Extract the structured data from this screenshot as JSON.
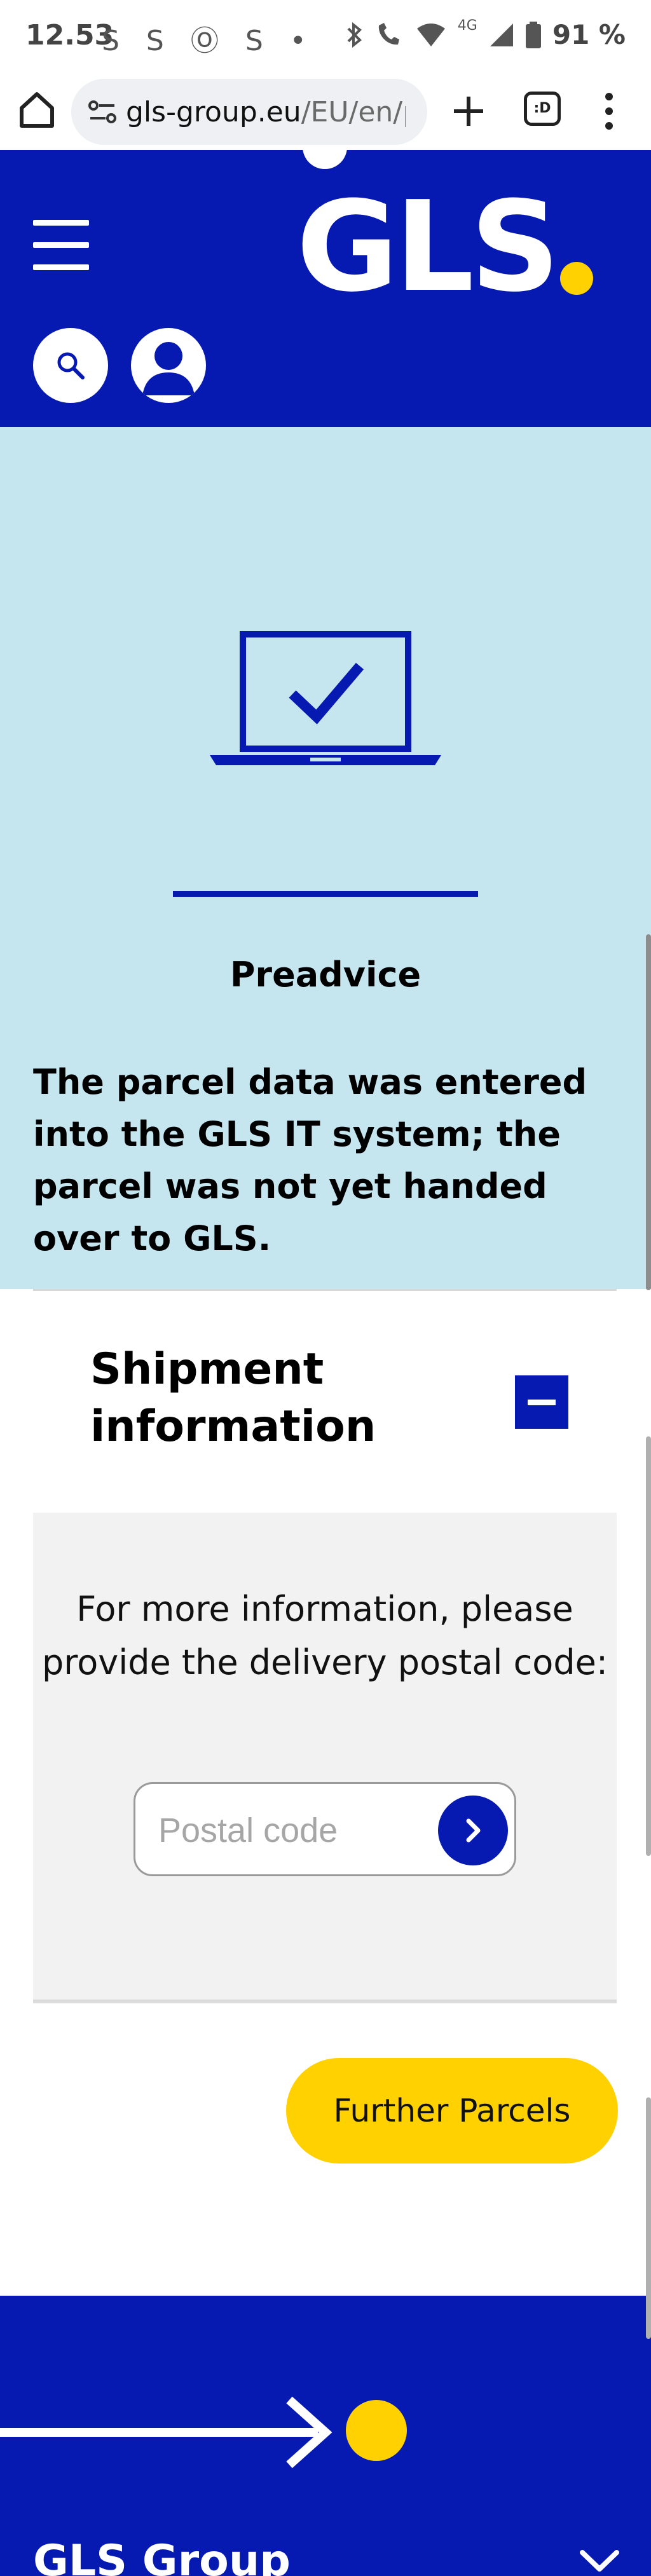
{
  "status_bar": {
    "time": "12.53",
    "notifications": "S S Ⓞ S •",
    "network": "4G",
    "battery": "91 %"
  },
  "browser": {
    "url_domain": "gls-group.eu",
    "url_path": "/EU/en/p",
    "tabs_label": ":D"
  },
  "header": {
    "logo_text": "GLS",
    "colors": {
      "brand_blue": "#061ab1",
      "brand_yellow": "#ffd100"
    }
  },
  "status_panel": {
    "title": "Preadvice",
    "description": "The parcel data was entered into the GLS IT system; the parcel was not yet handed over to GLS.",
    "background": "#c5e6ef"
  },
  "shipment": {
    "title": "Shipment information",
    "info_text": "For more information, please provide the delivery postal code:",
    "postal_placeholder": "Postal code",
    "postal_value": "",
    "further_label": "Further Parcels"
  },
  "footer": {
    "group_label": "GLS Group"
  }
}
